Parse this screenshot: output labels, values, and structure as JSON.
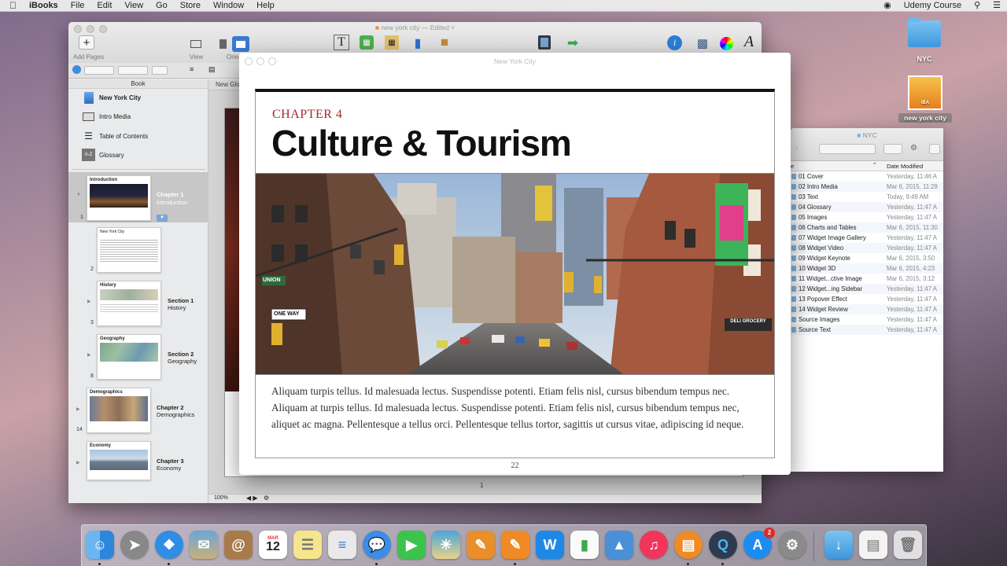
{
  "menubar": {
    "app": "iBooks",
    "menus": [
      "File",
      "Edit",
      "View",
      "Go",
      "Store",
      "Window",
      "Help"
    ],
    "status_user": "Udemy Course"
  },
  "desktop": {
    "folder_label": "NYC",
    "file_label": "new york city",
    "file_badge": "IBA"
  },
  "main_window": {
    "title": "new york city",
    "edited": "Edited",
    "add_pages": "Add Pages",
    "view": "View",
    "orientation": "Orientat"
  },
  "sidebar": {
    "header": "Book",
    "book_items": [
      {
        "label": "New York City",
        "icon": "book-icon"
      },
      {
        "label": "Intro Media",
        "icon": "film-icon"
      },
      {
        "label": "Table of Contents",
        "icon": "list-icon"
      },
      {
        "label": "Glossary",
        "icon": "az-icon"
      }
    ],
    "pages": [
      {
        "num": "1",
        "thumb_title": "Introduction",
        "chapter": "Chapter 1",
        "subtitle": "Introduction"
      },
      {
        "num": "2",
        "thumb_title": "New York City"
      },
      {
        "num": "3",
        "thumb_title": "History",
        "chapter": "Section 1",
        "subtitle": "History"
      },
      {
        "num": "8",
        "thumb_title": "Geography",
        "chapter": "Section 2",
        "subtitle": "Geography"
      },
      {
        "num": "14",
        "thumb_title": "Demographics",
        "chapter": "Chapter 2",
        "subtitle": "Demographics"
      },
      {
        "num": "",
        "thumb_title": "Economy",
        "chapter": "Chapter 3",
        "subtitle": "Economy"
      }
    ]
  },
  "canvas": {
    "tab_label": "New Glo",
    "zoom": "100%",
    "page_indicator": "1"
  },
  "page_popup": {
    "title": "New York City",
    "chapter_kicker": "CHAPTER 4",
    "chapter_title": "Culture & Tourism",
    "body": "Aliquam turpis tellus. Id malesuada lectus. Suspendisse potenti. Etiam felis nisl, cursus bibendum tempus nec. Aliquam at turpis tellus. Id malesuada lectus. Suspendisse potenti. Etiam felis nisl, cursus bibendum tempus nec, aliquet ac magna. Pellentesque a tellus orci. Pellentesque tellus tortor, sagittis ut cursus vitae, adipiscing id neque.",
    "page_number": "22",
    "sign_one_way": "ONE WAY",
    "sign_union": "UNION",
    "sign_deli": "DELI GROCERY"
  },
  "finder": {
    "title": "NYC",
    "col_name": "e",
    "col_date": "Date Modified",
    "rows": [
      {
        "name": "01 Cover",
        "date": "Yesterday, 11:46 A"
      },
      {
        "name": "02 Intro Media",
        "date": "Mar 6, 2015, 11:29"
      },
      {
        "name": "03 Text",
        "date": "Today, 9:49 AM"
      },
      {
        "name": "04 Glossary",
        "date": "Yesterday, 11:47 A"
      },
      {
        "name": "05 Images",
        "date": "Yesterday, 11:47 A"
      },
      {
        "name": "06 Charts and Tables",
        "date": "Mar 6, 2015, 11:30"
      },
      {
        "name": "07 Widget Image Gallery",
        "date": "Yesterday, 11:47 A"
      },
      {
        "name": "08 Widget Video",
        "date": "Yesterday, 11:47 A"
      },
      {
        "name": "09 Widget Keynote",
        "date": "Mar 6, 2015, 3:50"
      },
      {
        "name": "10 Widget 3D",
        "date": "Mar 6, 2015, 4:23"
      },
      {
        "name": "11 Widget...ctive Image",
        "date": "Mar 6, 2015, 3:12"
      },
      {
        "name": "12 Widget...ing Sidebar",
        "date": "Yesterday, 11:47 A"
      },
      {
        "name": "13 Popover Effect",
        "date": "Yesterday, 11:47 A"
      },
      {
        "name": "14 Widget Review",
        "date": "Yesterday, 11:47 A"
      },
      {
        "name": "Source Images",
        "date": "Yesterday, 11:47 A"
      },
      {
        "name": "Source Text",
        "date": "Yesterday, 11:47 A"
      }
    ]
  },
  "dock": {
    "calendar_month": "MAR",
    "calendar_day": "12",
    "appstore_badge": "2"
  }
}
